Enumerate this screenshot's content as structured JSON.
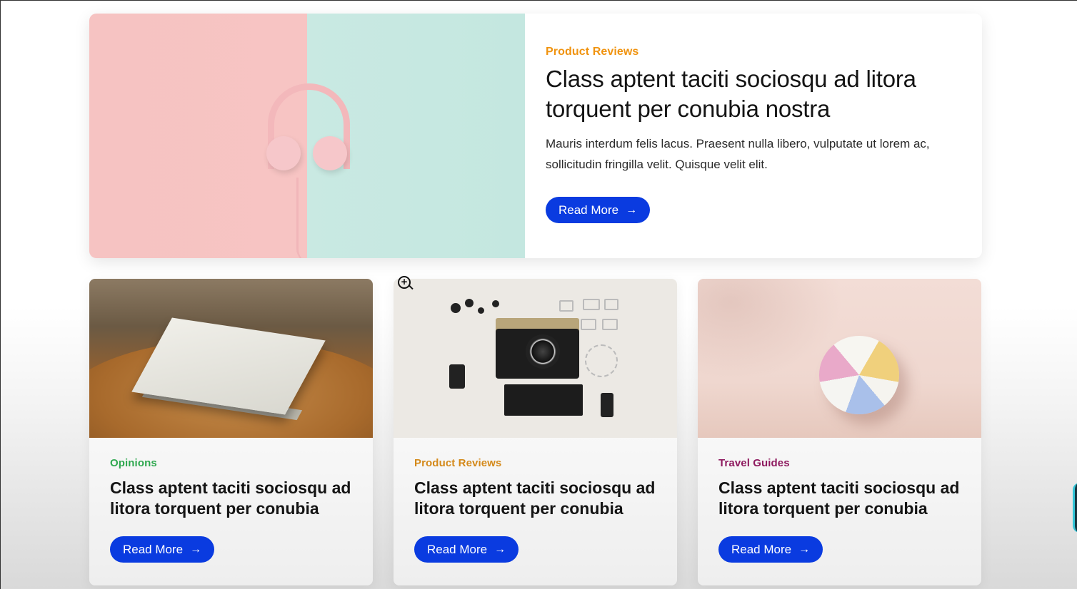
{
  "featured": {
    "category": "Product Reviews",
    "category_color": "#f0930f",
    "title": "Class aptent taciti sociosqu ad litora torquent per conubia nostra",
    "excerpt": "Mauris interdum felis lacus. Praesent nulla libero, vulputate ut lorem ac, sollicitudin fringilla velit. Quisque velit elit.",
    "button_label": "Read More",
    "button_icon": "arrow-right-icon",
    "image": "headphones-photo"
  },
  "cards": [
    {
      "category": "Opinions",
      "category_color": "#2fa84f",
      "title": "Class aptent taciti sociosqu ad litora torquent per conubia",
      "button_label": "Read More",
      "image": "book-on-table-photo"
    },
    {
      "category": "Product Reviews",
      "category_color": "#f0930f",
      "title": "Class aptent taciti sociosqu ad litora torquent per conubia",
      "button_label": "Read More",
      "image": "camera-flatlay-photo"
    },
    {
      "category": "Travel Guides",
      "category_color": "#8e1a5f",
      "title": "Class aptent taciti sociosqu ad litora torquent per conubia",
      "button_label": "Read More",
      "image": "beach-ball-photo"
    }
  ],
  "colors": {
    "button": "#0a3be0",
    "button_text": "#ffffff"
  },
  "cursor": "zoom-in-icon"
}
